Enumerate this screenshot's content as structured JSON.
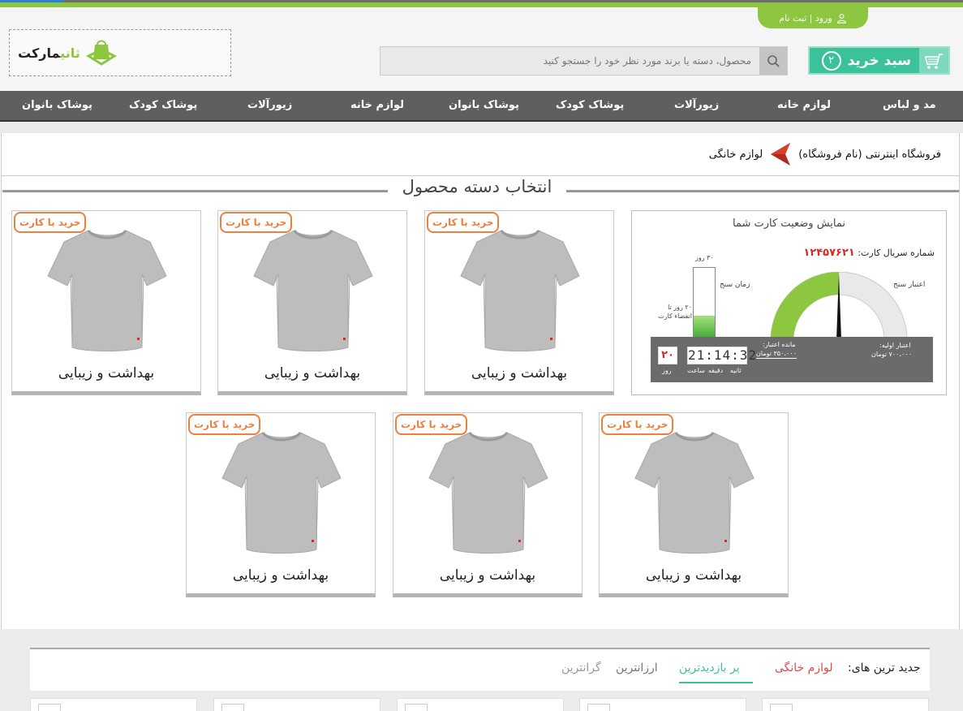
{
  "header": {
    "login_label": "ورود | ثبت نام",
    "logo": {
      "part1": "ثانی",
      "part2": "مارکت"
    },
    "search_placeholder": "محصول، دسته یا برند مورد نظر خود را جستجو کنید",
    "cart_label": "سبد خرید",
    "cart_count": "۲"
  },
  "nav": {
    "items": [
      "مد و لباس",
      "لوازم خانه",
      "زیورآلات",
      "پوشاک کودک",
      "پوشاک بانوان",
      "لوازم خانه",
      "زیورآلات",
      "پوشاک کودک",
      "پوشاک بانوان"
    ]
  },
  "breadcrumb": {
    "store": "فروشگاه اینترنتی (نام فروشگاه)",
    "current": "لوازم خانگی"
  },
  "section": {
    "title": "انتخاب دسته محصول"
  },
  "products": [
    {
      "badge": "خرید با کارت",
      "title": "بهداشت و زیبایی"
    },
    {
      "badge": "خرید با کارت",
      "title": "بهداشت و زیبایی"
    },
    {
      "badge": "خرید با کارت",
      "title": "بهداشت و زیبایی"
    },
    {
      "badge": "خرید با کارت",
      "title": "بهداشت و زیبایی"
    },
    {
      "badge": "خرید با کارت",
      "title": "بهداشت و زیبایی"
    },
    {
      "badge": "خرید با کارت",
      "title": "بهداشت و زیبایی"
    }
  ],
  "status_panel": {
    "title": "نمایش وضعیت کارت شما",
    "serial_label": "شماره سریال کارت:",
    "serial_value": "۱۲۴۵۷۶۲۱",
    "credit_meter_label": "اعتبار سنج",
    "time_meter_label": "زمان سنج",
    "max_days_label": "۳۰ روز",
    "expiry_label": "۲۰ روز تا انقضاء کارت",
    "initial_credit_label": "اعتبار اولیه:",
    "initial_credit_value": "۷۰۰،۰۰۰ تومان",
    "remaining_credit_label": "مانده اعتبار:",
    "remaining_credit_value": "۳۵۰،۰۰۰ تومان",
    "timer": "21:14:32",
    "timer_units": [
      "ثانیه",
      "دقیقه",
      "ساعت"
    ],
    "days_value": "۲۰",
    "days_unit": "روز",
    "credit_fraction": 0.5,
    "time_fraction": 0.33
  },
  "footer_tabs": {
    "lead": "جدید ترین های:",
    "items": [
      "لوازم خانگی",
      "پر بازدیدترین",
      "ارزانترین",
      "گرانترین"
    ],
    "active": "پر بازدیدترین"
  },
  "colors": {
    "brand_green": "#8dc63f",
    "cart_teal": "#3cc29a",
    "badge_orange": "#f07f3c",
    "nav_grey": "#5f5f5f",
    "alert_red": "#d12c2c"
  }
}
